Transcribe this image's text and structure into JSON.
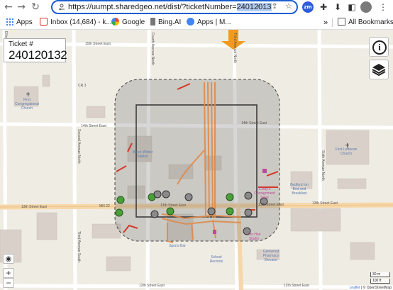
{
  "browser": {
    "url_prefix": "https://uumpt.sharedgeo.net/dist/?ticketNumber=",
    "url_selected": "24012013",
    "bookmarks": [
      {
        "label": "Apps",
        "color": "#4285f4"
      },
      {
        "label": "Inbox (14,684) - k...",
        "color": "#d93025"
      },
      {
        "label": "Google",
        "color": "#4285f4"
      },
      {
        "label": "Bing.AI",
        "color": "#5a5a5a"
      },
      {
        "label": "Apps | M...",
        "color": "#4285f4"
      }
    ],
    "bookmarks_overflow": "»",
    "all_bookmarks": "All Bookmarks",
    "ext_zm": "zm",
    "menu": "⋮"
  },
  "ticket": {
    "label": "Ticket #",
    "number": "240120132"
  },
  "map": {
    "info_label": "i",
    "zoom_in": "+",
    "zoom_out": "−",
    "locate": "◉",
    "scale_m": "30 m",
    "scale_ft": "100 ft",
    "attribution_leaflet": "Leaflet",
    "attribution_osm": "© OpenStreetMap",
    "streets": {
      "s15": "15th Street East",
      "s14": "14th Street East",
      "s14b": "14th Street East",
      "s13a": "13th Street East",
      "s13b": "13th Street East",
      "s13c": "13th Street East",
      "s13d": "13th Street East",
      "s12a": "12th Street East",
      "s12b": "12th Street East",
      "mn22": "MN 22",
      "cr3": "CR 3",
      "elliott": "Elliott Avenue North",
      "fourth": "Fourth Avenue North",
      "third": "Third Avenue North",
      "second": "Second Avenue North",
      "sixth": "Sixth Avenue North",
      "third_s": "Third Avenue South"
    },
    "pois": {
      "first_cong": "First Congregational Church",
      "winter_garden": "Weez Winter Station",
      "first_lutheran": "First Lutheran Church",
      "cindys": "Cindy's Consignment Store",
      "bed": "Bedford Inn Bed and Breakfast",
      "hair": "The Hair Studio",
      "sports_bar": "Sports Bar",
      "glenwood": "Glenwood Pharmacy Elevator",
      "school": "School Records"
    }
  }
}
